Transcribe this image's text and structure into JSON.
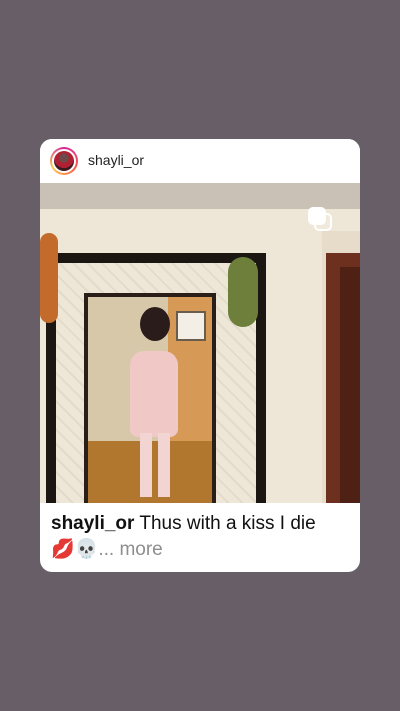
{
  "post": {
    "username": "shayli_or",
    "caption": {
      "username": "shayli_or",
      "text": "Thus with a kiss I die",
      "emoji": "💋💀",
      "more_label": "... more"
    }
  },
  "icons": {
    "avatar": "profile-avatar",
    "multi": "multi-photo-icon"
  },
  "colors": {
    "background": "#675e68",
    "card": "#ffffff",
    "text": "#111111",
    "muted": "#8e8e8e"
  }
}
